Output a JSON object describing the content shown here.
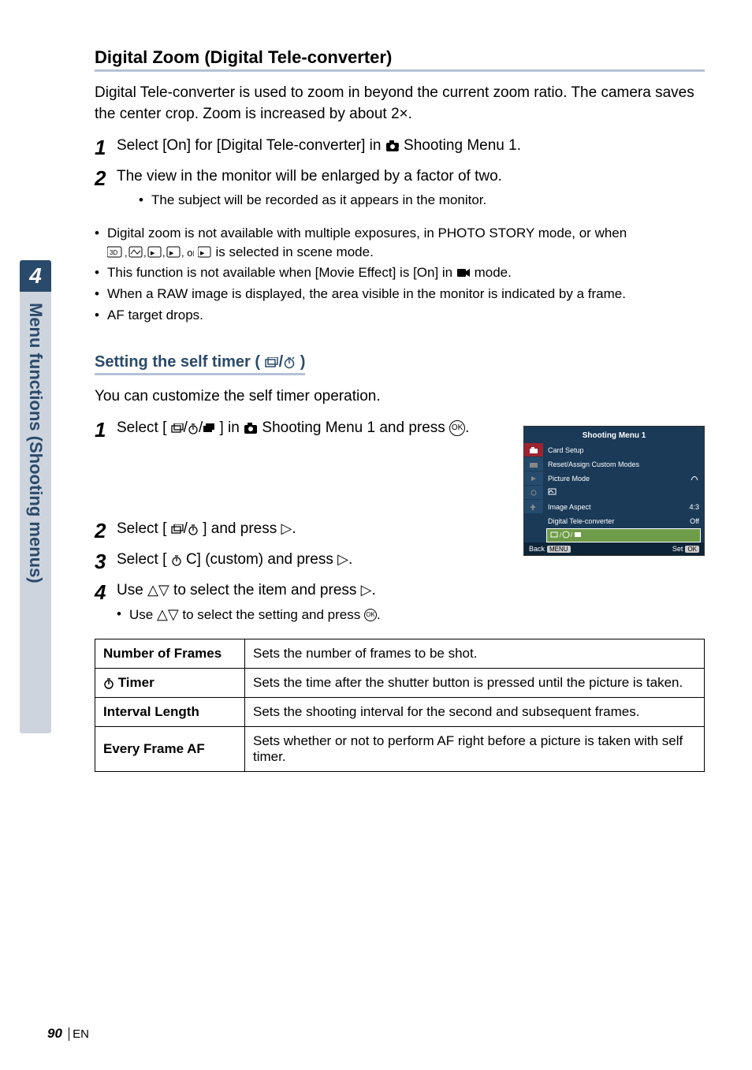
{
  "sidebar": {
    "chapter_number": "4",
    "chapter_title": "Menu functions (Shooting menus)"
  },
  "section1": {
    "heading": "Digital Zoom (Digital Tele-converter)",
    "intro": "Digital Tele-converter is used to zoom in beyond the current zoom ratio. The camera saves the center crop. Zoom is increased by about 2×.",
    "step1_text_a": "Select [On] for [Digital Tele-converter] in ",
    "step1_text_b": " Shooting Menu 1.",
    "step2_text": "The view in the monitor will be enlarged by a factor of two.",
    "step2_sub": "The subject will be recorded as it appears in the monitor.",
    "note1_a": "Digital zoom is not available with multiple exposures, in PHOTO STORY mode, or when ",
    "note1_b": " is selected in scene mode.",
    "note2_a": "This function is not available when [Movie Effect] is [On] in ",
    "note2_b": " mode.",
    "note3": "When a RAW image is displayed, the area visible in the monitor is indicated by a frame.",
    "note4": "AF target drops."
  },
  "section2": {
    "heading_a": "Setting the self timer (",
    "heading_b": ")",
    "intro": "You can customize the self timer operation.",
    "step1_a": "Select [",
    "step1_b": "] in ",
    "step1_c": " Shooting Menu 1 and press ",
    "step1_d": ".",
    "step2_a": "Select [",
    "step2_b": "] and press ",
    "step2_c": ".",
    "step3_a": "Select [",
    "step3_b": "C] (custom) and press ",
    "step3_c": ".",
    "step4_a": "Use ",
    "step4_b": " to select the item and press ",
    "step4_c": ".",
    "step4_sub_a": "Use ",
    "step4_sub_b": " to select the setting and press ",
    "step4_sub_c": "."
  },
  "table": {
    "rows": [
      {
        "label": "Number of Frames",
        "desc": "Sets the number of frames to be shot."
      },
      {
        "label_prefix_icon": "timer",
        "label": " Timer",
        "desc": "Sets the time after the shutter button is pressed until the picture is taken."
      },
      {
        "label": "Interval Length",
        "desc": "Sets the shooting interval for the second and subsequent frames."
      },
      {
        "label": "Every Frame AF",
        "desc": "Sets whether or not to perform AF right before a picture is taken with self timer."
      }
    ]
  },
  "lcd": {
    "title": "Shooting Menu 1",
    "rows": [
      {
        "label": "Card Setup",
        "value": ""
      },
      {
        "label": "Reset/Assign Custom Modes",
        "value": ""
      },
      {
        "label": "Picture Mode",
        "value": ""
      },
      {
        "label": "",
        "value": ""
      },
      {
        "label": "Image Aspect",
        "value": "4:3"
      },
      {
        "label": "Digital Tele-converter",
        "value": "Off"
      }
    ],
    "highlight_label": "",
    "back": "Back",
    "set": "Set"
  },
  "footer": {
    "page": "90",
    "lang": "EN"
  },
  "icons": {
    "camera1_tooltip": "Shooting Menu 1 icon",
    "movie_tooltip": "Movie mode icon",
    "drive_timer_tooltip": "Drive/Self-timer icon",
    "timer_tooltip": "Self-timer icon",
    "ok_label": "OK",
    "scene_modes_tooltip": "3D, Panorama, e-Portrait group"
  }
}
